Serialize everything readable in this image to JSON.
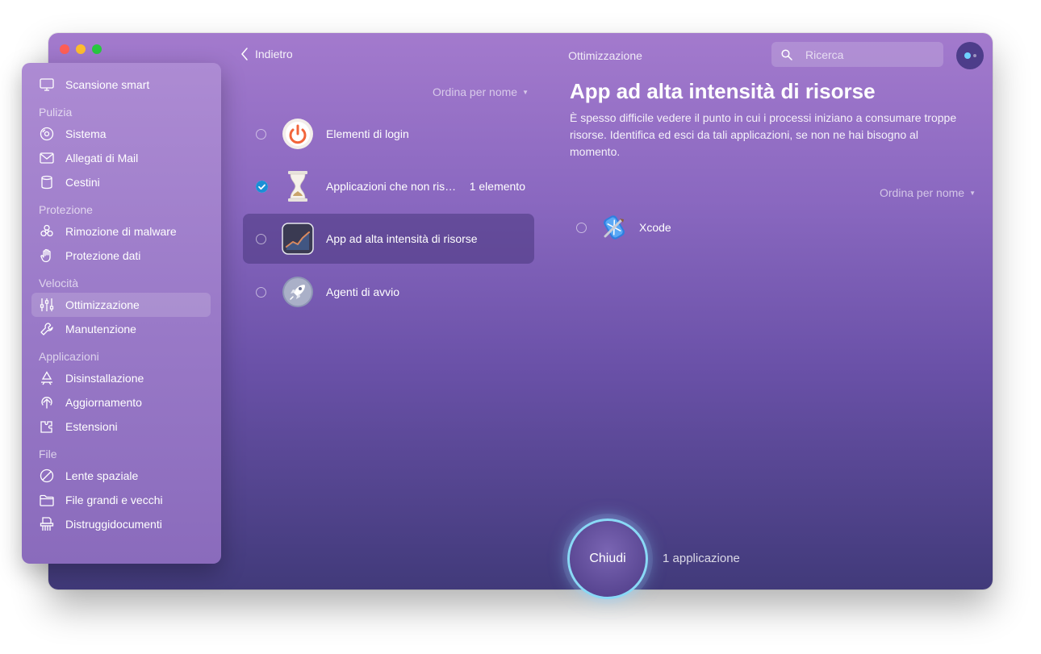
{
  "toolbar": {
    "back_label": "Indietro",
    "title": "Ottimizzazione",
    "search_placeholder": "Ricerca"
  },
  "sidebar": {
    "top_item": {
      "label": "Scansione smart",
      "icon": "monitor-icon"
    },
    "sections": [
      {
        "title": "Pulizia",
        "items": [
          {
            "label": "Sistema",
            "icon": "disk-icon"
          },
          {
            "label": "Allegati di Mail",
            "icon": "envelope-icon"
          },
          {
            "label": "Cestini",
            "icon": "trash-icon"
          }
        ]
      },
      {
        "title": "Protezione",
        "items": [
          {
            "label": "Rimozione di malware",
            "icon": "biohazard-icon"
          },
          {
            "label": "Protezione dati",
            "icon": "hand-icon"
          }
        ]
      },
      {
        "title": "Velocità",
        "items": [
          {
            "label": "Ottimizzazione",
            "icon": "sliders-icon",
            "active": true
          },
          {
            "label": "Manutenzione",
            "icon": "wrench-icon"
          }
        ]
      },
      {
        "title": "Applicazioni",
        "items": [
          {
            "label": "Disinstallazione",
            "icon": "apps-icon"
          },
          {
            "label": "Aggiornamento",
            "icon": "update-arrow-icon"
          },
          {
            "label": "Estensioni",
            "icon": "extension-icon"
          }
        ]
      },
      {
        "title": "File",
        "items": [
          {
            "label": "Lente spaziale",
            "icon": "lens-icon"
          },
          {
            "label": "File grandi e vecchi",
            "icon": "folder-icon"
          },
          {
            "label": "Distruggidocumenti",
            "icon": "shredder-icon"
          }
        ]
      }
    ]
  },
  "list": {
    "sort_label": "Ordina per nome",
    "items": [
      {
        "label": "Elementi di login",
        "icon": "power-icon",
        "checked": false,
        "count": ""
      },
      {
        "label": "Applicazioni che non ris…",
        "icon": "hourglass-icon",
        "checked": true,
        "count": "1 elemento"
      },
      {
        "label": "App ad alta intensità di risorse",
        "icon": "chart-line-icon",
        "checked": false,
        "count": "",
        "selected": true
      },
      {
        "label": "Agenti di avvio",
        "icon": "rocket-icon",
        "checked": false,
        "count": ""
      }
    ]
  },
  "detail": {
    "title": "App ad alta intensità di risorse",
    "description": "È spesso difficile vedere il punto in cui i processi iniziano a consumare troppe risorse. Identifica ed esci da tali applicazioni, se non ne hai bisogno al momento.",
    "sort_label": "Ordina per nome",
    "apps": [
      {
        "name": "Xcode",
        "icon": "xcode-icon",
        "checked": false
      }
    ]
  },
  "action": {
    "button_label": "Chiudi",
    "count_label": "1 applicazione"
  },
  "colors": {
    "accent_ring": "#8ad9f6",
    "check": "#1a8fd6",
    "window_top": "#a37acd",
    "window_bottom": "#413a7a"
  }
}
